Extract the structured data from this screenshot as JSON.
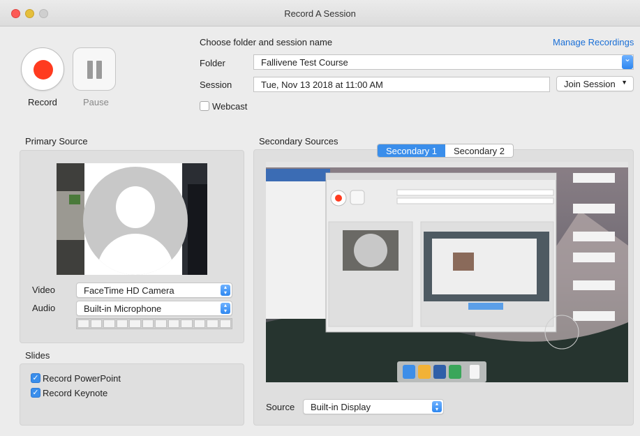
{
  "window": {
    "title": "Record A Session"
  },
  "controls": {
    "record_label": "Record",
    "pause_label": "Pause"
  },
  "session": {
    "heading": "Choose folder and session name",
    "manage_link": "Manage Recordings",
    "folder_label": "Folder",
    "folder_value": "Fallivene Test Course",
    "session_label": "Session",
    "session_value": "Tue, Nov 13 2018 at 11:00 AM",
    "join_label": "Join Session",
    "webcast_label": "Webcast"
  },
  "primary": {
    "title": "Primary Source",
    "video_label": "Video",
    "video_value": "FaceTime HD Camera",
    "audio_label": "Audio",
    "audio_value": "Built-in Microphone"
  },
  "slides": {
    "title": "Slides",
    "ppt_label": "Record PowerPoint",
    "keynote_label": "Record Keynote"
  },
  "secondary": {
    "title": "Secondary Sources",
    "tabs": [
      "Secondary 1",
      "Secondary 2"
    ],
    "source_label": "Source",
    "source_value": "Built-in Display"
  },
  "colors": {
    "accent": "#3a8eeb",
    "record_red": "#ff3b1f",
    "link": "#1a6fd6"
  }
}
